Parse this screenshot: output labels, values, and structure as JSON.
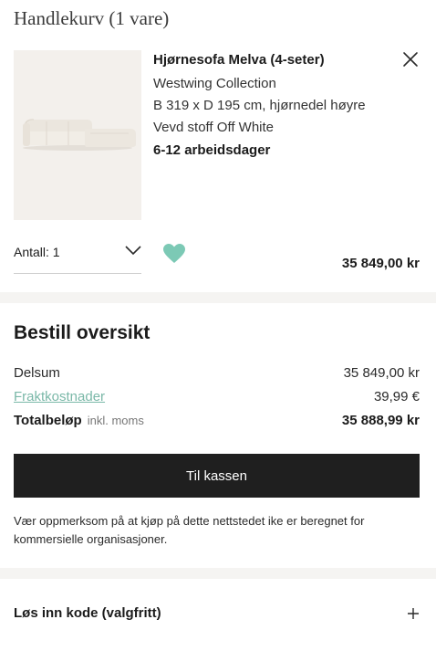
{
  "cart": {
    "title": "Handlekurv (1 vare)"
  },
  "product": {
    "name": "Hjørnesofa Melva (4-seter)",
    "brand": "Westwing Collection",
    "dimensions": "B 319 x D 195 cm, hjørnedel høyre",
    "material": "Vevd stoff Off White",
    "delivery": "6-12 arbeidsdager",
    "quantity_label": "Antall: 1",
    "price": "35 849,00 kr",
    "image_icon": "corner-sofa-image",
    "wishlist_color": "#7cc9b5"
  },
  "summary": {
    "title": "Bestill oversikt",
    "subtotal_label": "Delsum",
    "subtotal_value": "35 849,00 kr",
    "shipping_label": "Fraktkostnader",
    "shipping_value": "39,99 €",
    "total_label": "Totalbeløp",
    "total_note": "inkl. moms",
    "total_value": "35 888,99 kr",
    "checkout_label": "Til kassen",
    "notice": "Vær oppmerksom på at kjøp på dette nettstedet ike er beregnet for kommersielle organisasjoner."
  },
  "promo": {
    "label": "Løs inn kode (valgfritt)"
  },
  "colors": {
    "accent": "#7ab8a8",
    "button": "#1f1f1f",
    "band": "#f5f4f2"
  }
}
